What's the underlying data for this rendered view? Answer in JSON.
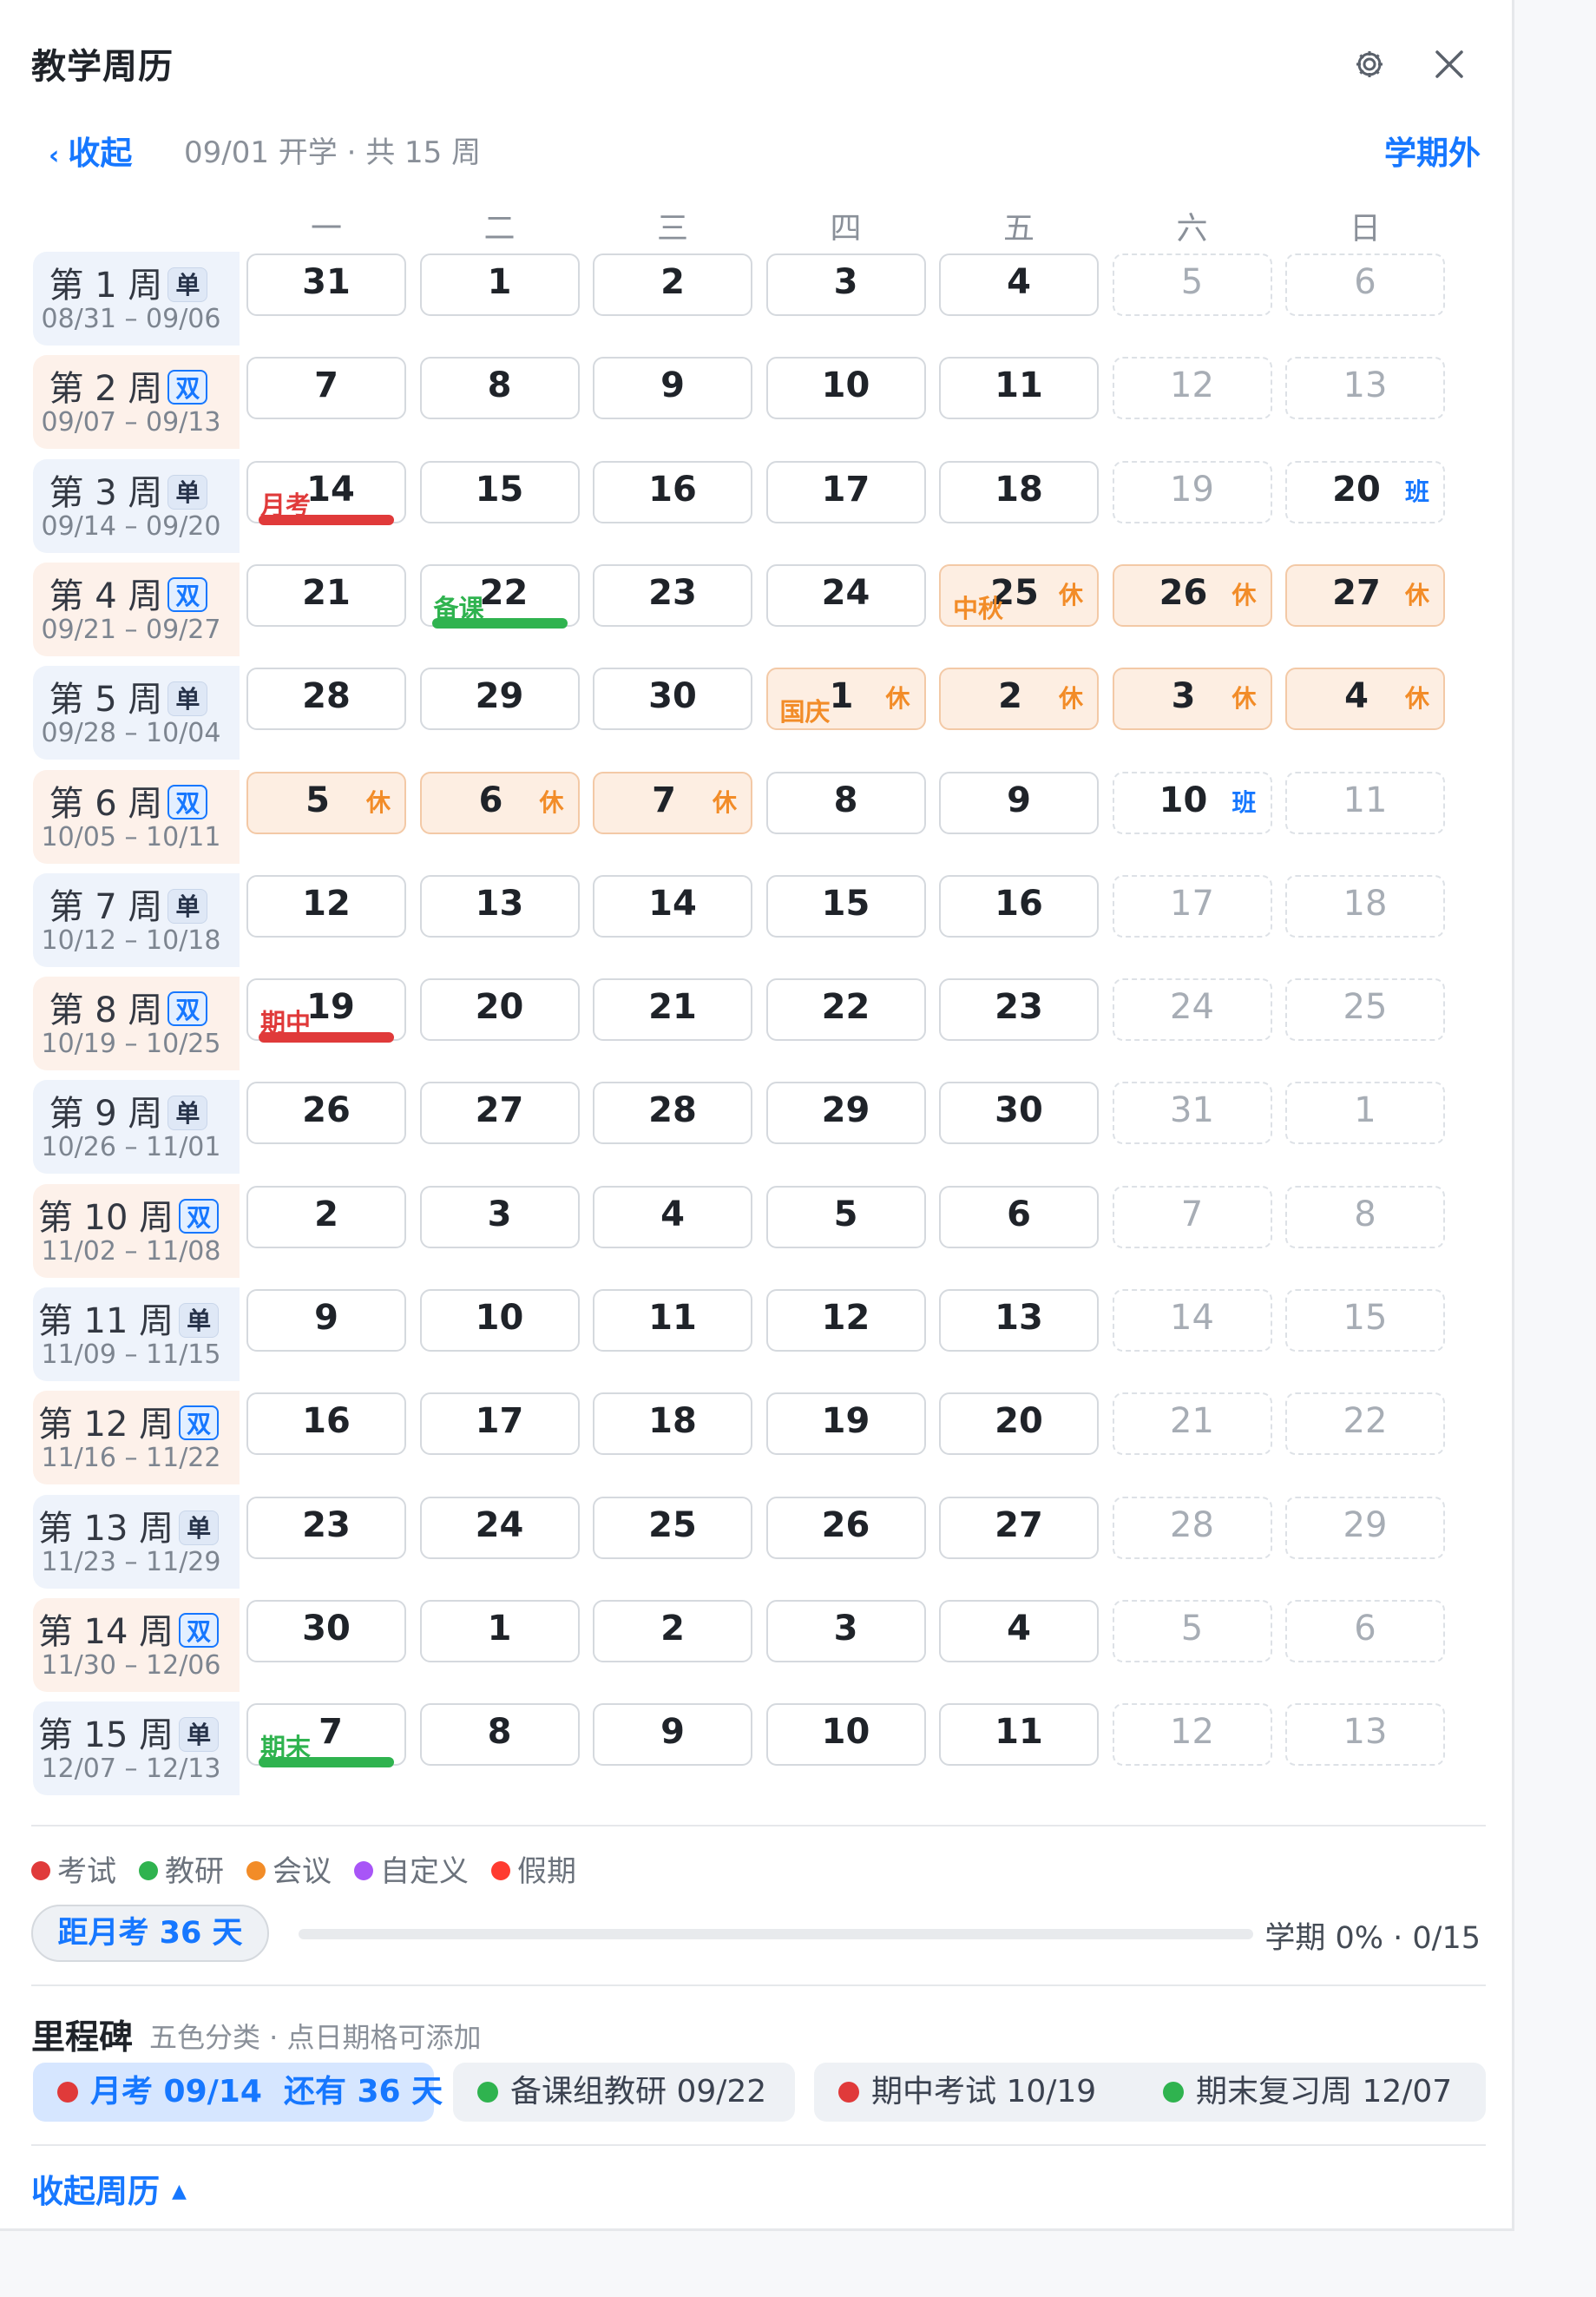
{
  "header": {
    "title": "教学周历",
    "settings_icon": "gear-icon",
    "close_icon": "close-icon"
  },
  "subheader": {
    "collapse_label": "收起",
    "term_info": "09/01 开学 · 共 15 周",
    "out_of_term_label": "学期外"
  },
  "weekdays": [
    "一",
    "二",
    "三",
    "四",
    "五",
    "六",
    "日"
  ],
  "colors": {
    "exam": "#e03a3a",
    "research": "#2fb34f",
    "meeting": "#f28c28",
    "custom": "#a855f7",
    "holiday": "#ff3b30",
    "accent": "#1677ff"
  },
  "weeks": [
    {
      "label": "第 1 周",
      "badge": "单",
      "range": "08/31 – 09/06",
      "days": [
        {
          "n": "31"
        },
        {
          "n": "1"
        },
        {
          "n": "2"
        },
        {
          "n": "3"
        },
        {
          "n": "4"
        },
        {
          "n": "5"
        },
        {
          "n": "6"
        }
      ]
    },
    {
      "label": "第 2 周",
      "badge": "双",
      "range": "09/07 – 09/13",
      "days": [
        {
          "n": "7"
        },
        {
          "n": "8"
        },
        {
          "n": "9"
        },
        {
          "n": "10"
        },
        {
          "n": "11"
        },
        {
          "n": "12"
        },
        {
          "n": "13"
        }
      ]
    },
    {
      "label": "第 3 周",
      "badge": "单",
      "range": "09/14 – 09/20",
      "days": [
        {
          "n": "14",
          "ev": "月考",
          "evc": "red",
          "bar": "red"
        },
        {
          "n": "15"
        },
        {
          "n": "16"
        },
        {
          "n": "17"
        },
        {
          "n": "18"
        },
        {
          "n": "19"
        },
        {
          "n": "20",
          "tag": "班"
        }
      ]
    },
    {
      "label": "第 4 周",
      "badge": "双",
      "range": "09/21 – 09/27",
      "days": [
        {
          "n": "21"
        },
        {
          "n": "22",
          "ev": "备课",
          "evc": "green",
          "bar": "green"
        },
        {
          "n": "23"
        },
        {
          "n": "24"
        },
        {
          "n": "25",
          "ev": "中秋",
          "evc": "orange",
          "tag": "休"
        },
        {
          "n": "26",
          "tag": "休"
        },
        {
          "n": "27",
          "tag": "休"
        }
      ]
    },
    {
      "label": "第 5 周",
      "badge": "单",
      "range": "09/28 – 10/04",
      "days": [
        {
          "n": "28"
        },
        {
          "n": "29"
        },
        {
          "n": "30"
        },
        {
          "n": "1",
          "ev": "国庆",
          "evc": "orange",
          "tag": "休"
        },
        {
          "n": "2",
          "tag": "休"
        },
        {
          "n": "3",
          "tag": "休"
        },
        {
          "n": "4",
          "tag": "休"
        }
      ]
    },
    {
      "label": "第 6 周",
      "badge": "双",
      "range": "10/05 – 10/11",
      "days": [
        {
          "n": "5",
          "tag": "休"
        },
        {
          "n": "6",
          "tag": "休"
        },
        {
          "n": "7",
          "tag": "休"
        },
        {
          "n": "8"
        },
        {
          "n": "9"
        },
        {
          "n": "10",
          "tag": "班"
        },
        {
          "n": "11"
        }
      ]
    },
    {
      "label": "第 7 周",
      "badge": "单",
      "range": "10/12 – 10/18",
      "days": [
        {
          "n": "12"
        },
        {
          "n": "13"
        },
        {
          "n": "14"
        },
        {
          "n": "15"
        },
        {
          "n": "16"
        },
        {
          "n": "17"
        },
        {
          "n": "18"
        }
      ]
    },
    {
      "label": "第 8 周",
      "badge": "双",
      "range": "10/19 – 10/25",
      "days": [
        {
          "n": "19",
          "ev": "期中",
          "evc": "red",
          "bar": "red"
        },
        {
          "n": "20"
        },
        {
          "n": "21"
        },
        {
          "n": "22"
        },
        {
          "n": "23"
        },
        {
          "n": "24"
        },
        {
          "n": "25"
        }
      ]
    },
    {
      "label": "第 9 周",
      "badge": "单",
      "range": "10/26 – 11/01",
      "days": [
        {
          "n": "26"
        },
        {
          "n": "27"
        },
        {
          "n": "28"
        },
        {
          "n": "29"
        },
        {
          "n": "30"
        },
        {
          "n": "31"
        },
        {
          "n": "1"
        }
      ]
    },
    {
      "label": "第 10 周",
      "badge": "双",
      "range": "11/02 – 11/08",
      "days": [
        {
          "n": "2"
        },
        {
          "n": "3"
        },
        {
          "n": "4"
        },
        {
          "n": "5"
        },
        {
          "n": "6"
        },
        {
          "n": "7"
        },
        {
          "n": "8"
        }
      ]
    },
    {
      "label": "第 11 周",
      "badge": "单",
      "range": "11/09 – 11/15",
      "days": [
        {
          "n": "9"
        },
        {
          "n": "10"
        },
        {
          "n": "11"
        },
        {
          "n": "12"
        },
        {
          "n": "13"
        },
        {
          "n": "14"
        },
        {
          "n": "15"
        }
      ]
    },
    {
      "label": "第 12 周",
      "badge": "双",
      "range": "11/16 – 11/22",
      "days": [
        {
          "n": "16"
        },
        {
          "n": "17"
        },
        {
          "n": "18"
        },
        {
          "n": "19"
        },
        {
          "n": "20"
        },
        {
          "n": "21"
        },
        {
          "n": "22"
        }
      ]
    },
    {
      "label": "第 13 周",
      "badge": "单",
      "range": "11/23 – 11/29",
      "days": [
        {
          "n": "23"
        },
        {
          "n": "24"
        },
        {
          "n": "25"
        },
        {
          "n": "26"
        },
        {
          "n": "27"
        },
        {
          "n": "28"
        },
        {
          "n": "29"
        }
      ]
    },
    {
      "label": "第 14 周",
      "badge": "双",
      "range": "11/30 – 12/06",
      "days": [
        {
          "n": "30"
        },
        {
          "n": "1"
        },
        {
          "n": "2"
        },
        {
          "n": "3"
        },
        {
          "n": "4"
        },
        {
          "n": "5"
        },
        {
          "n": "6"
        }
      ]
    },
    {
      "label": "第 15 周",
      "badge": "单",
      "range": "12/07 – 12/13",
      "days": [
        {
          "n": "7",
          "ev": "期末",
          "evc": "green",
          "bar": "green"
        },
        {
          "n": "8"
        },
        {
          "n": "9"
        },
        {
          "n": "10"
        },
        {
          "n": "11"
        },
        {
          "n": "12"
        },
        {
          "n": "13"
        }
      ]
    }
  ],
  "legend": [
    {
      "label": "考试",
      "color": "#e03a3a"
    },
    {
      "label": "教研",
      "color": "#2fb34f"
    },
    {
      "label": "会议",
      "color": "#f28c28"
    },
    {
      "label": "自定义",
      "color": "#a855f7"
    },
    {
      "label": "假期",
      "color": "#ff3b30"
    }
  ],
  "progress": {
    "countdown": "距月考 36 天",
    "percent": 0,
    "text": "学期 0% · 0/15"
  },
  "milestones": {
    "title": "里程碑",
    "subtitle": "五色分类 · 点日期格可添加",
    "items": [
      {
        "label": "月考 09/14  还有 36 天",
        "color": "#e03a3a",
        "active": true
      },
      {
        "label": "备课组教研 09/22",
        "color": "#2fb34f"
      },
      {
        "label": "期中考试 10/19",
        "color": "#e03a3a"
      },
      {
        "label": "期末复习周 12/07",
        "color": "#2fb34f"
      }
    ]
  },
  "footer": {
    "collapse_calendar": "收起周历"
  }
}
